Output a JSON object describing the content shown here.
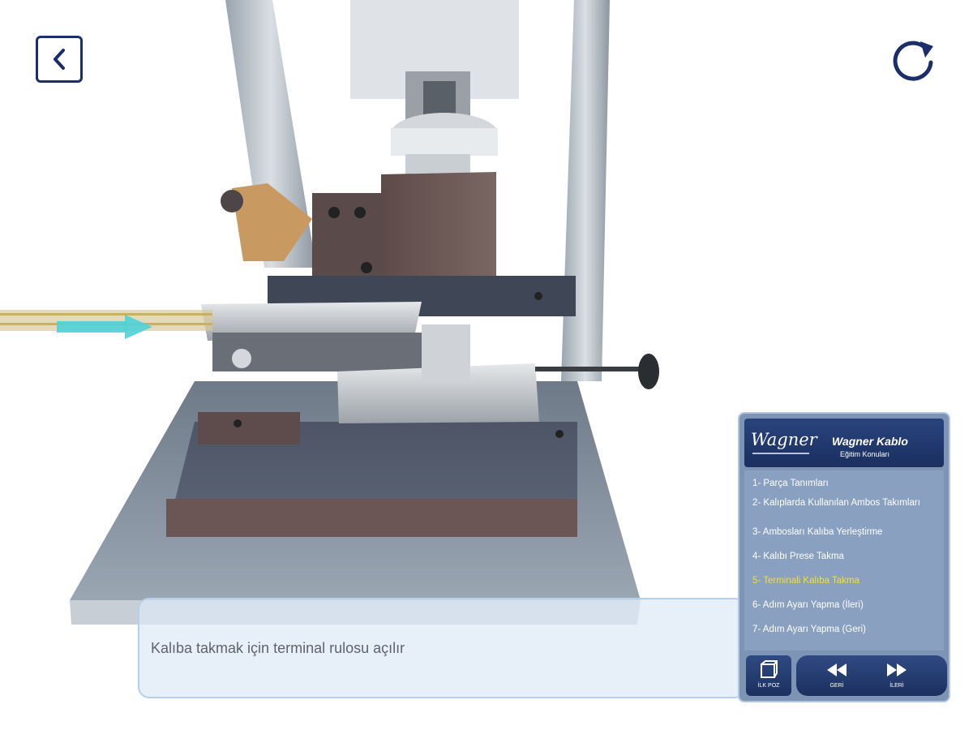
{
  "caption": {
    "text": "Kalıba takmak için terminal rulosu açılır"
  },
  "panel": {
    "logo": "Wagner",
    "brand_title": "Wagner Kablo",
    "brand_subtitle": "Eğitim Konuları",
    "items": [
      {
        "label": "1- Parça Tanımları"
      },
      {
        "label": "2- Kalıplarda Kullanılan Ambos Takımları"
      },
      {
        "label": "3- Ambosları Kalıba Yerleştirme"
      },
      {
        "label": "4- Kalıbı Prese Takma"
      },
      {
        "label": "5- Terminali Kalıba Takma"
      },
      {
        "label": "6- Adım Ayarı Yapma (İleri)"
      },
      {
        "label": "7- Adım Ayarı Yapma (Geri)"
      }
    ],
    "active_index": 4,
    "controls": {
      "first_pos": "İLK POZ",
      "back": "GERİ",
      "forward": "İLERİ"
    }
  },
  "colors": {
    "nav_icon": "#1c2d6b",
    "active_item": "#f4e12a",
    "panel_bg": "#7e94b5",
    "panel_header": "#1b2f60"
  },
  "icons": {
    "back": "chevron-left-icon",
    "reload": "refresh-icon",
    "first_pos": "cube-icon",
    "rewind": "rewind-icon",
    "fast_forward": "fast-forward-icon"
  }
}
